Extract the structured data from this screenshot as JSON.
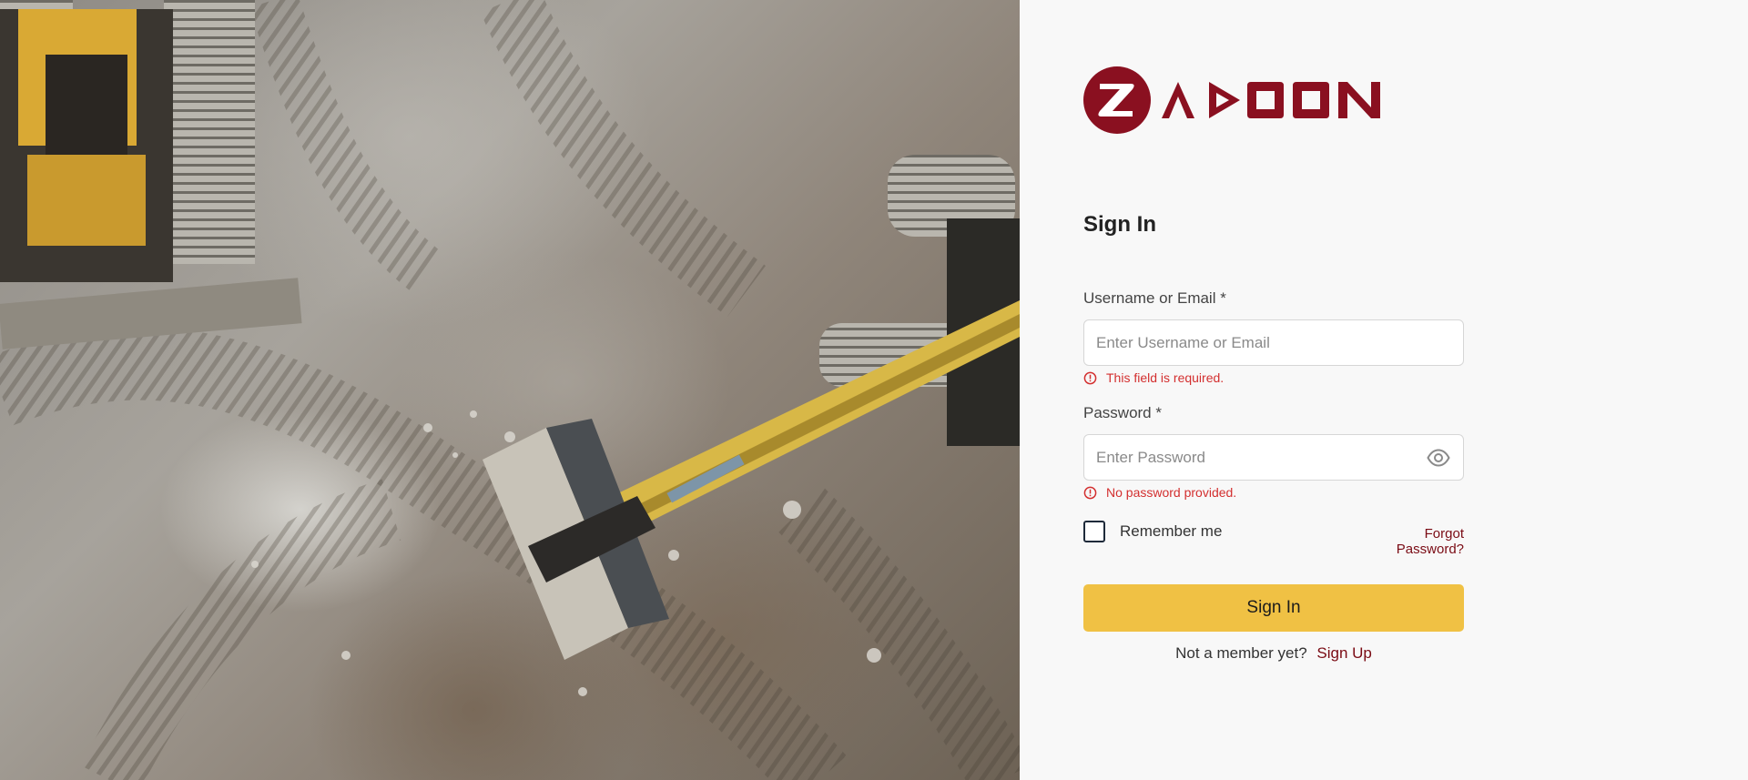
{
  "brand": {
    "name": "ZADOON",
    "accent_color": "#8a1020"
  },
  "hero_image": {
    "description_icon": "photo"
  },
  "form": {
    "heading": "Sign In",
    "username": {
      "label": "Username or Email *",
      "placeholder": "Enter Username or Email",
      "value": "",
      "error": "This field is required."
    },
    "password": {
      "label": "Password *",
      "placeholder": "Enter Password",
      "value": "",
      "error": "No password provided.",
      "toggle_icon": "eye-icon"
    },
    "remember_me": {
      "label": "Remember me",
      "checked": false
    },
    "forgot_password": "Forgot Password?",
    "submit_label": "Sign In",
    "signup_prompt": "Not a member yet?",
    "signup_link": "Sign Up"
  },
  "colors": {
    "primary_button": "#f0c144",
    "error": "#d32f2f",
    "link": "#7a0b14",
    "panel_background": "#f8f8f8"
  }
}
